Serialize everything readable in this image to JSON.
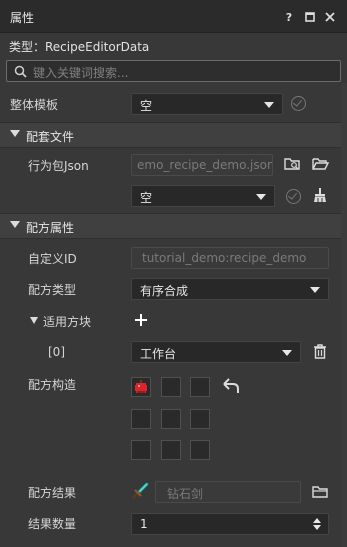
{
  "window": {
    "title": "属性"
  },
  "title_buttons": {
    "help": "?"
  },
  "type_line": "类型：RecipeEditorData",
  "search": {
    "placeholder": "键入关键词搜索..."
  },
  "template_row": {
    "label": "整体模板",
    "value": "空"
  },
  "section_files": {
    "label": "配套文件"
  },
  "behavior_json": {
    "label": "行为包Json",
    "path": "emo_recipe_demo.json",
    "select_value": "空"
  },
  "section_recipe": {
    "label": "配方属性"
  },
  "custom_id": {
    "label": "自定义ID",
    "value": "tutorial_demo:recipe_demo"
  },
  "recipe_type": {
    "label": "配方类型",
    "value": "有序合成"
  },
  "applicable_block": {
    "label": "适用方块",
    "index": "[0]",
    "value": "工作台"
  },
  "recipe_structure": {
    "label": "配方构造"
  },
  "recipe_result": {
    "label": "配方结果",
    "value": "钻石剑"
  },
  "result_count": {
    "label": "结果数量",
    "value": "1"
  },
  "colors": {
    "background": "#383838",
    "titlebar": "#2b2b2b",
    "section": "#404040",
    "apple": "#d9262a",
    "sword": "#4fd8cf"
  }
}
